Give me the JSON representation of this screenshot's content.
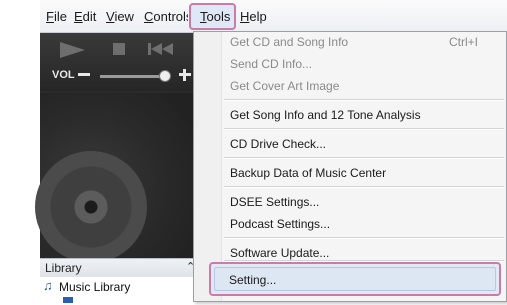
{
  "menubar": {
    "items": [
      "File",
      "Edit",
      "View",
      "Controls",
      "Tools",
      "Help"
    ],
    "mnemonics": [
      "F",
      "E",
      "V",
      "C",
      "T",
      "H"
    ],
    "rest": [
      "ile",
      "dit",
      "iew",
      "ontrols",
      "ools",
      "elp"
    ]
  },
  "player": {
    "vol_label": "VOL",
    "volume_level": 0.95
  },
  "library": {
    "header": "Library",
    "pin": "⌃",
    "items": [
      "Music Library"
    ]
  },
  "tools_menu": {
    "items": [
      {
        "label": "Get CD and Song Info",
        "shortcut": "Ctrl+I",
        "enabled": false
      },
      {
        "label": "Send CD Info...",
        "enabled": false
      },
      {
        "label": "Get Cover Art Image",
        "enabled": false
      },
      {
        "label": "Get Song Info and 12 Tone Analysis",
        "enabled": true
      },
      {
        "label": "CD Drive Check...",
        "enabled": true
      },
      {
        "label": "Backup Data of Music Center",
        "enabled": true
      },
      {
        "label": "DSEE Settings...",
        "enabled": true
      },
      {
        "label": "Podcast Settings...",
        "enabled": true
      },
      {
        "label": "Software Update...",
        "enabled": true
      },
      {
        "label": "Setting...",
        "enabled": true
      }
    ]
  },
  "colors": {
    "highlight_border": "#c97ca5",
    "menu_hover": "#dfe8f6"
  }
}
